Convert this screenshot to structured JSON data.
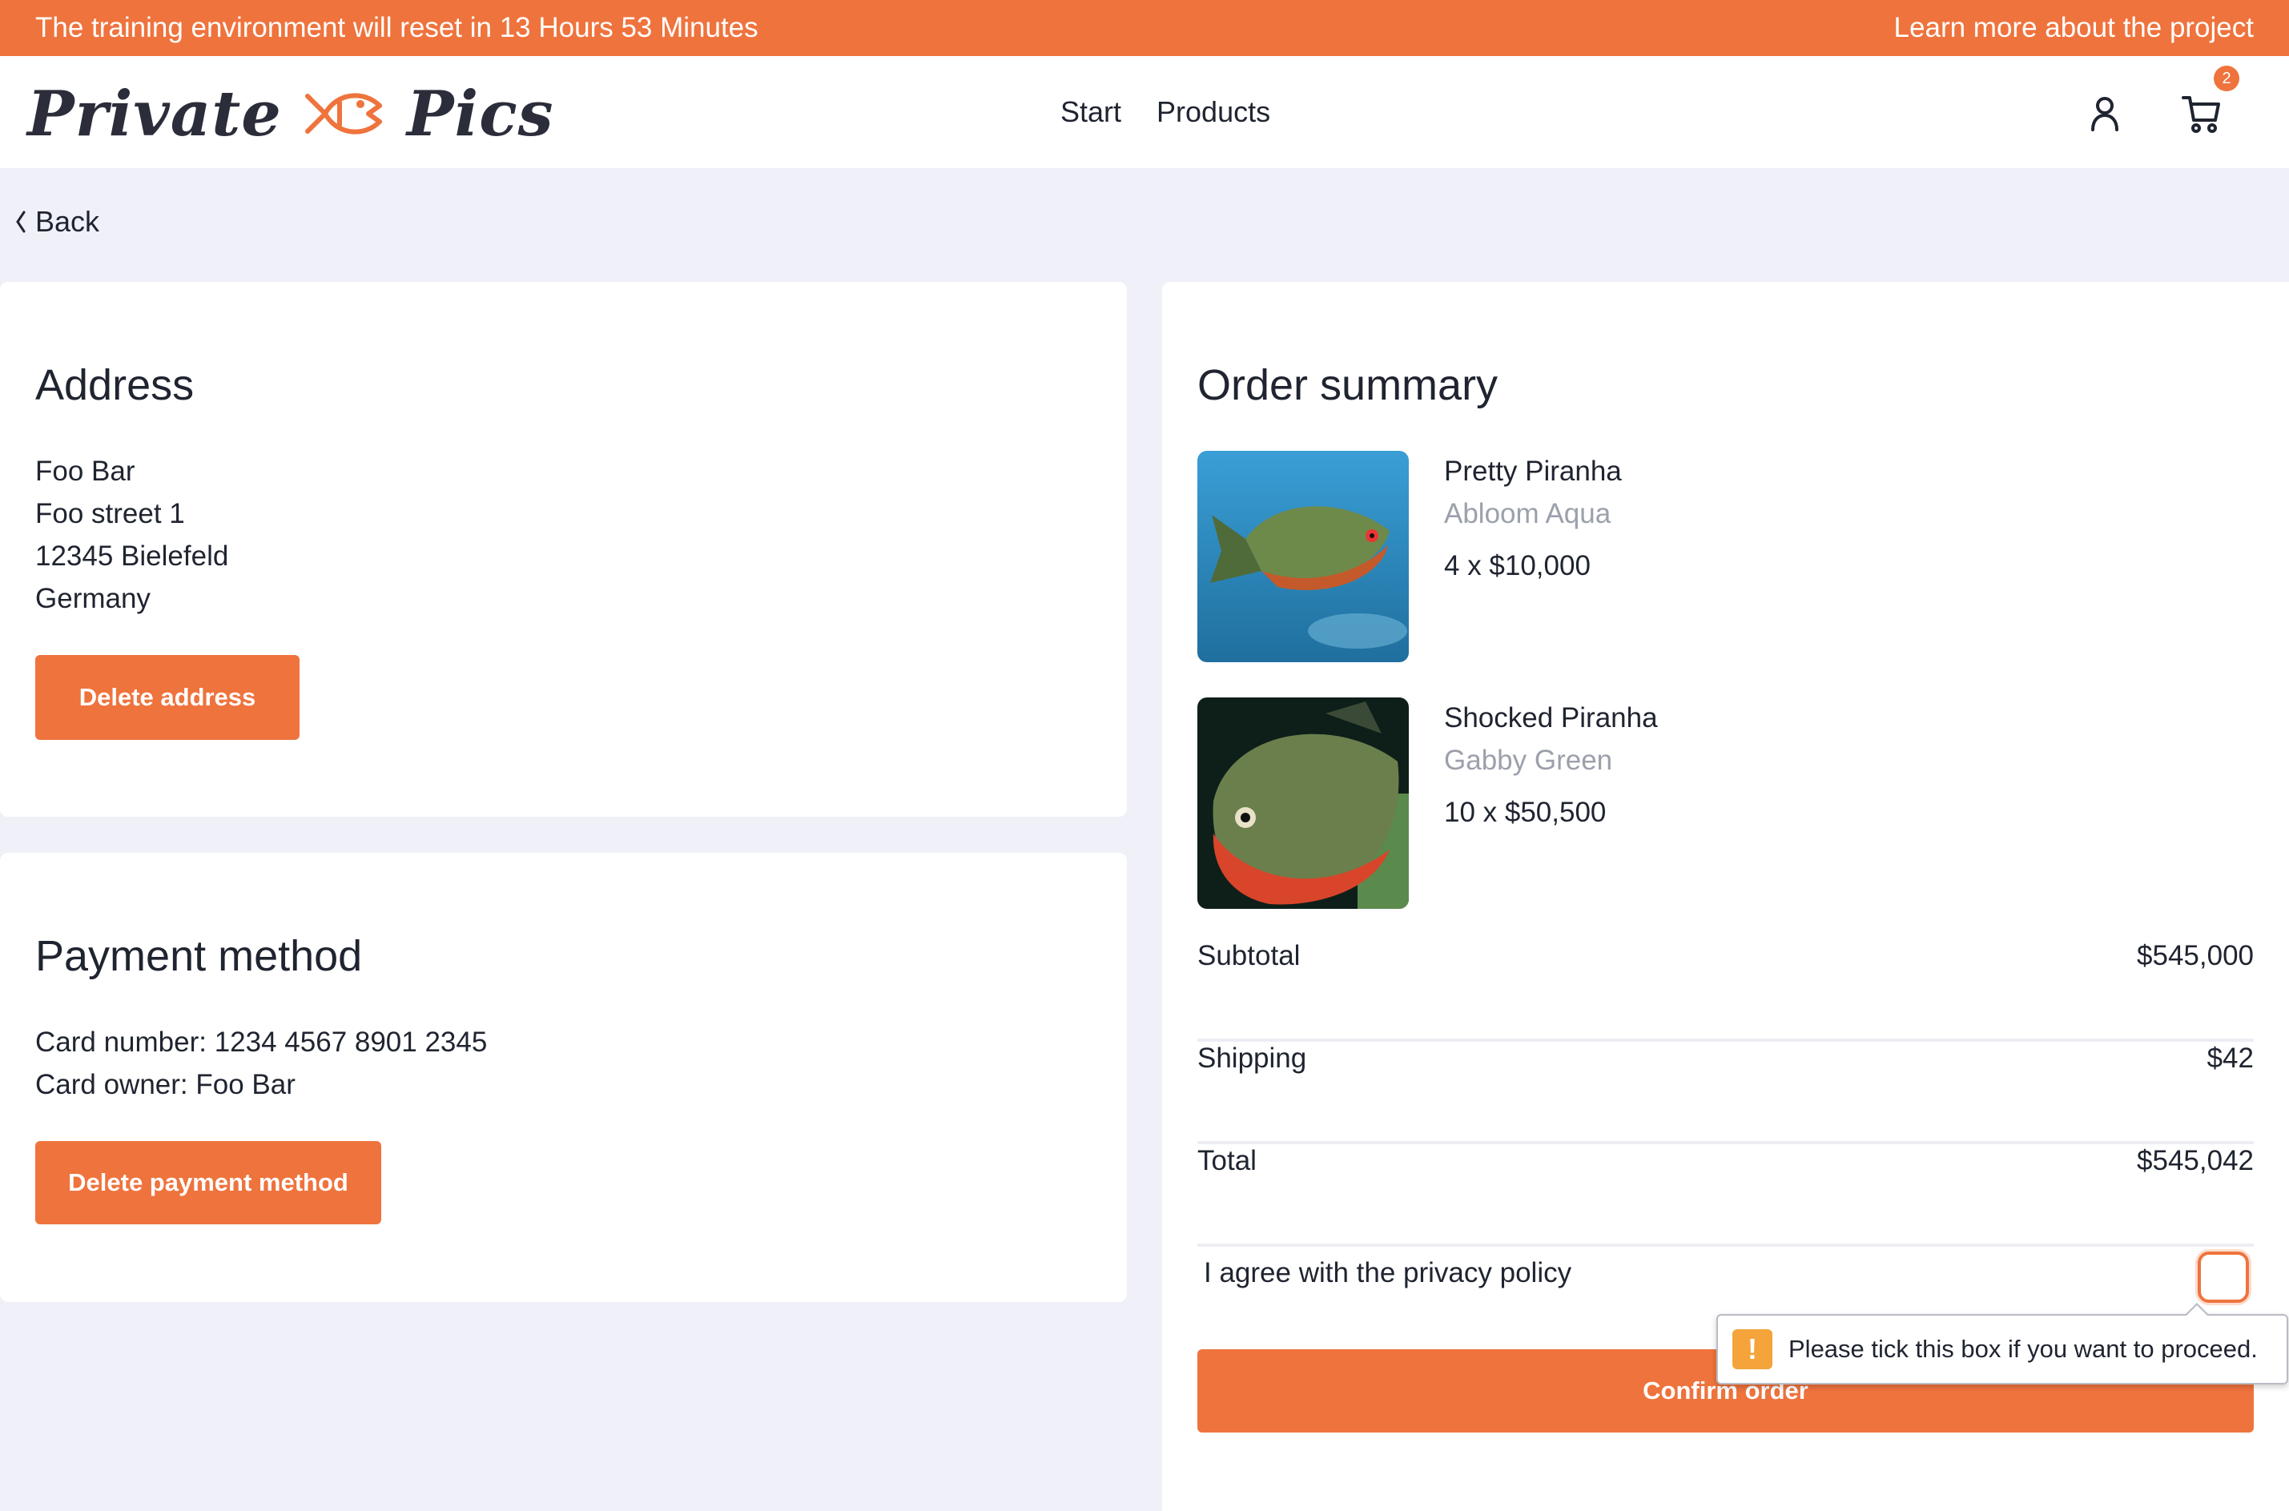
{
  "banner": {
    "reset_text": "The training environment will reset in 13 Hours 53 Minutes",
    "learn_more": "Learn more about the project"
  },
  "header": {
    "logo_left": "Private",
    "logo_right": "Pics",
    "nav": [
      "Start",
      "Products"
    ],
    "cart_count": "2"
  },
  "back_label": "Back",
  "address": {
    "title": "Address",
    "lines": [
      "Foo Bar",
      "Foo street 1",
      "12345 Bielefeld",
      "Germany"
    ],
    "delete_label": "Delete address"
  },
  "payment": {
    "title": "Payment method",
    "lines": [
      "Card number: 1234 4567 8901 2345",
      "Card owner: Foo Bar"
    ],
    "delete_label": "Delete payment method"
  },
  "summary": {
    "title": "Order summary",
    "items": [
      {
        "name": "Pretty Piranha",
        "variant": "Abloom Aqua",
        "qty": "4 x $10,000"
      },
      {
        "name": "Shocked Piranha",
        "variant": "Gabby Green",
        "qty": "10 x $50,500"
      }
    ],
    "rows": [
      {
        "label": "Subtotal",
        "value": "$545,000"
      },
      {
        "label": "Shipping",
        "value": "$42"
      },
      {
        "label": "Total",
        "value": "$545,042"
      }
    ],
    "privacy_label": "I agree with the privacy policy",
    "confirm_label": "Confirm order",
    "tooltip": "Please tick this box if you want to proceed."
  },
  "colors": {
    "accent": "#ef733d",
    "background": "#eff0f8",
    "muted_text": "#9ba0ab",
    "warning": "#f4a43a"
  }
}
